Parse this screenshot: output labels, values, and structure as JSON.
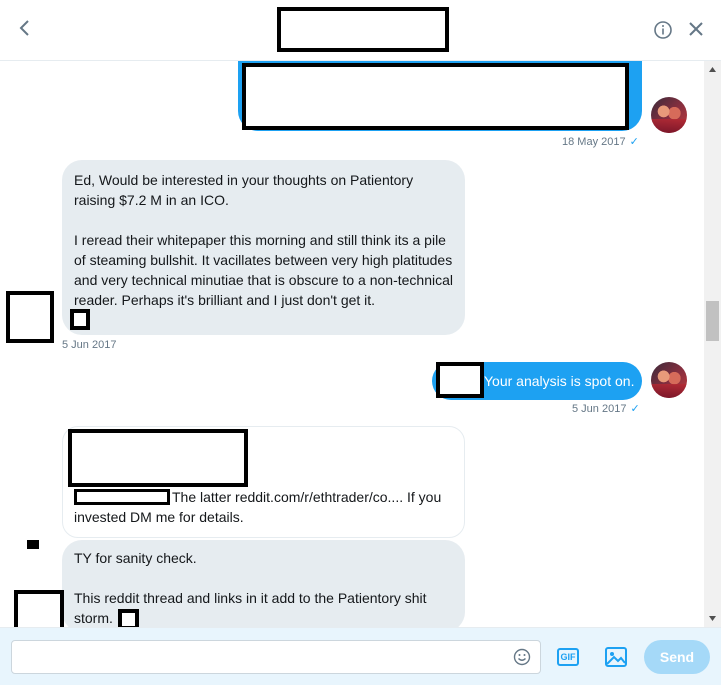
{
  "header": {
    "back_icon": "chevron-left-icon",
    "info_icon": "info-circle-icon",
    "close_icon": "close-x-icon"
  },
  "messages": {
    "m1_timestamp": "18 May 2017",
    "m1_check": "✓",
    "m2": {
      "p1": "Ed, Would be interested in your thoughts on Patientory raising $7.2 M in an ICO.",
      "p2": "I reread their whitepaper this morning and still think its a pile of steaming bullshit. It vacillates between very high platitudes and very technical minutiae that is obscure to a non-technical reader. Perhaps it's brilliant and I just don't get it.",
      "timestamp": "5 Jun 2017"
    },
    "m3": {
      "text": "Your analysis is spot on.",
      "timestamp": "5 Jun 2017",
      "check": "✓"
    },
    "m4": {
      "text_line1": "The latter reddit.com/r/ethtrader/co.... If you",
      "text_line2": "invested DM me for details."
    },
    "m5": {
      "p1": "TY for sanity check.",
      "p2_line1": "This reddit thread and links in it add to the Patientory shit",
      "p2_line2": "storm."
    }
  },
  "composer": {
    "input_value": "",
    "input_placeholder": "",
    "gif_label": "GIF",
    "send_label": "Send",
    "emoji_icon": "smiley-icon",
    "image_icon": "image-icon"
  },
  "colors": {
    "accent": "#1da1f2",
    "incoming_bubble": "#e6ecf0",
    "send_disabled": "#a5d9f8",
    "composer_bg": "#e8f5fd"
  }
}
